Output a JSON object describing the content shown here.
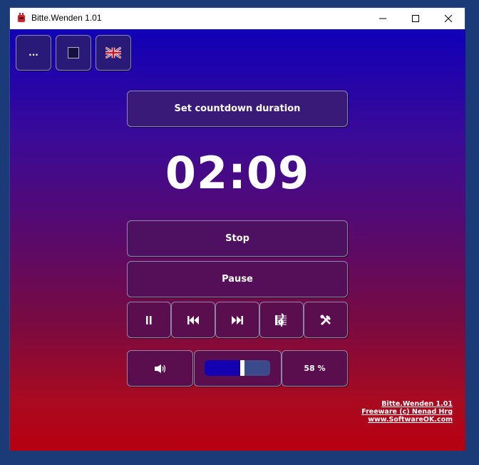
{
  "window": {
    "title": "Bitte.Wenden 1.01",
    "controls": {
      "minimize": "—",
      "maximize": "☐",
      "close": "✕"
    }
  },
  "toolbar": {
    "more_label": "...",
    "stop_square_icon": "stop-square-icon",
    "language_icon": "uk-flag-icon"
  },
  "main": {
    "set_duration_label": "Set countdown duration",
    "timer": "02:09",
    "stop_label": "Stop",
    "pause_label": "Pause"
  },
  "controls": {
    "pause_glyph": "⏸",
    "prev_glyph": "⏮",
    "next_glyph": "⏭",
    "music_glyph": "𝄞",
    "tools_glyph": "🛠"
  },
  "volume": {
    "speaker_glyph": "🔈",
    "value_percent": 58,
    "label": "58 %"
  },
  "footer": {
    "line1": "Bitte.Wenden 1.01",
    "line2": "Freeware (c) Nenad Hrg",
    "line3": "www.SoftwareOK.com"
  },
  "colors": {
    "gradient_top": "#1000b8",
    "gradient_bottom": "#b80010",
    "desktop": "#1b3a78",
    "slider_fill": "#1400b0"
  }
}
